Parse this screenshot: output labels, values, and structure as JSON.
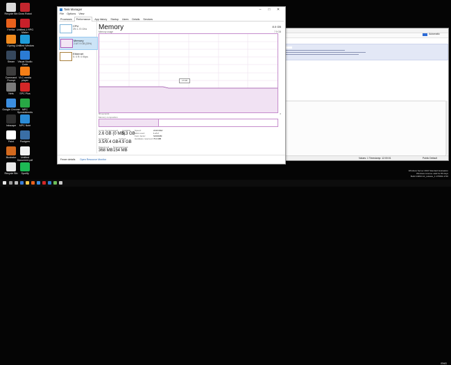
{
  "desktop": {
    "icons": [
      {
        "label": "Recycle Bin",
        "color": "#d9d9d9"
      },
      {
        "label": "Grow Robot",
        "color": "#c2262e"
      },
      {
        "label": "Firefox",
        "color": "#e8601c"
      },
      {
        "label": "Untitled-1 RPG Maker",
        "color": "#c8202a"
      },
      {
        "label": "iSpring",
        "color": "#f08a1e"
      },
      {
        "label": "Untitled Window 5",
        "color": "#1f9bd8"
      },
      {
        "label": "Steam",
        "color": "#35475c"
      },
      {
        "label": "Visual Studio Code",
        "color": "#2b7bd4"
      },
      {
        "label": "Command Prompt",
        "color": "#3d3d3d"
      },
      {
        "label": "VLC media player",
        "color": "#f57f17"
      },
      {
        "label": "Nets",
        "color": "#7a7a7a"
      },
      {
        "label": "SPC Plus",
        "color": "#d42727"
      },
      {
        "label": "Google Chrome",
        "color": "#3b8ee0"
      },
      {
        "label": "MPC Spreadsheets",
        "color": "#28a745"
      },
      {
        "label": "Inkscape",
        "color": "#2f2f2f"
      },
      {
        "label": "MPC Note",
        "color": "#2b8bd6"
      },
      {
        "label": "Paint",
        "color": "#ffffff"
      },
      {
        "label": "Postgres",
        "color": "#3a6ea5"
      },
      {
        "label": "Illustrator",
        "color": "#d2691e"
      },
      {
        "label": "Untitled Document.pdf",
        "color": "#f2f2f2"
      },
      {
        "label": "Recycle Bin",
        "color": "#e8e8e8"
      },
      {
        "label": "Spotify",
        "color": "#1db954"
      }
    ]
  },
  "taskmgr": {
    "title": "Task Manager",
    "menu": [
      "File",
      "Options",
      "View"
    ],
    "tabs": [
      "Processes",
      "Performance",
      "App history",
      "Startup",
      "Users",
      "Details",
      "Services"
    ],
    "active_tab": "Performance",
    "resources": [
      {
        "name": "CPU",
        "value": "3%  1.70 GHz"
      },
      {
        "name": "Memory",
        "value": "2.6/7.9 GB (33%)"
      },
      {
        "name": "Ethernet",
        "value": "S: 0 R: 0 Kbps"
      }
    ],
    "heading": "Memory",
    "total": "8.0 GB",
    "usage_label": "Memory usage",
    "max_label": "7.9 GB",
    "graph_tooltip": "2.6 GB",
    "footer_left": "60 seconds",
    "footer_right": "0",
    "composition_label": "Memory composition",
    "composition_fraction": 0.33,
    "stats": {
      "in_use_label": "In use (Compressed)",
      "in_use_value": "2.6 GB (0 MB)",
      "available_label": "Available",
      "available_value": "5.3 GB",
      "committed_label": "Committed",
      "committed_value": "3.5/9.4 GB",
      "cached_label": "Cached",
      "cached_value": "4.9 GB",
      "paged_label": "Paged pool",
      "paged_value": "368 MB",
      "nonpaged_label": "Non-paged pool",
      "nonpaged_value": "154 MB"
    },
    "details": [
      {
        "k": "Speed:",
        "v": "2133 MHz"
      },
      {
        "k": "Slots used:",
        "v": "1 of 2"
      },
      {
        "k": "Form factor:",
        "v": "SODIMM"
      },
      {
        "k": "Hardware reserved:",
        "v": "76.0 MB"
      }
    ],
    "fewer_details": "Fewer details",
    "open_monitor": "Open Resource Monitor",
    "window_buttons": [
      "–",
      "□",
      "✕"
    ]
  },
  "background_window": {
    "search_label": "Automatic",
    "status_left": "Values: 1  Timestamp: 12:00:01",
    "status_right": "Public Default"
  },
  "watermark": {
    "line1": "Windows Server 2016 Standard Evaluation",
    "line2": "Windows License valid for 80 days",
    "line3": "Build 14393.rs1_release_1.170602-1720"
  },
  "taskbar": {
    "tray_text": "ENG"
  }
}
